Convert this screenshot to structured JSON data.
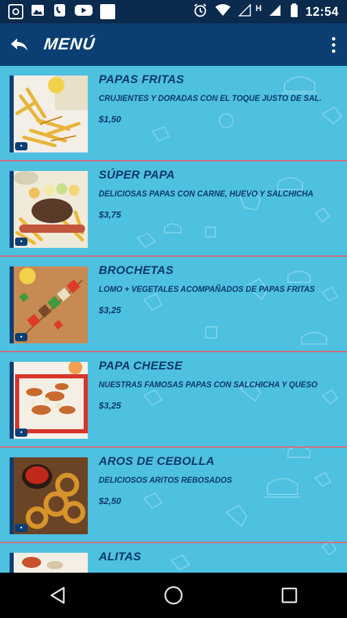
{
  "status_bar": {
    "time": "12:54",
    "network_label": "H",
    "icons": [
      "screenshot-icon",
      "image-icon",
      "phone-icon",
      "youtube-icon",
      "blank-app-icon",
      "alarm-icon",
      "wifi-icon",
      "signal-icon",
      "battery-icon"
    ]
  },
  "app_bar": {
    "title": "MENÚ",
    "back_icon": "back-arrow-icon",
    "more_icon": "more-vert-icon"
  },
  "menu": {
    "items": [
      {
        "name": "PAPAS FRITAS",
        "description": "CRUJIENTES Y DORADAS CON EL TOQUE JUSTO DE SAL.",
        "price": "$1,50",
        "image": "fries-image"
      },
      {
        "name": "SÚPER PAPA",
        "description": "DELICIOSAS PAPAS CON CARNE, HUEVO Y SALCHICHA",
        "price": "$3,75",
        "image": "super-papa-image"
      },
      {
        "name": "BROCHETAS",
        "description": "LOMO + VEGETALES ACOMPAÑADOS DE PAPAS FRITAS",
        "price": "$3,25",
        "image": "brochetas-image"
      },
      {
        "name": "PAPA CHEESE",
        "description": "NUESTRAS FAMOSAS PAPAS CON SALCHICHA Y QUESO",
        "price": "$3,25",
        "image": "papa-cheese-image"
      },
      {
        "name": "AROS DE CEBOLLA",
        "description": "DELICIOSOS ARITOS REBOSADOS",
        "price": "$2,50",
        "image": "onion-rings-image"
      },
      {
        "name": "ALITAS",
        "description": "",
        "price": "",
        "image": "alitas-image"
      }
    ]
  },
  "colors": {
    "status_bar": "#0a2a4e",
    "app_bar": "#0b3f73",
    "background": "#4ec0e0",
    "text": "#0b3a6a",
    "divider": "#d56a7a"
  },
  "nav_bar": {
    "icons": [
      "back-triangle-icon",
      "home-circle-icon",
      "recents-square-icon"
    ]
  }
}
